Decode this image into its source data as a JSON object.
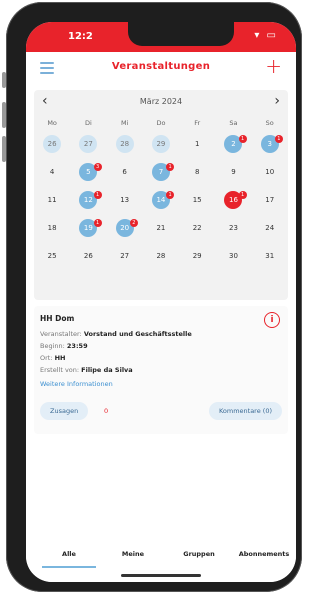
{
  "status": {
    "time": "12:2",
    "icons": "▾ ▭"
  },
  "header": {
    "title": "Veranstaltungen",
    "add": "+"
  },
  "calendar": {
    "prev": "‹",
    "next": "›",
    "month": "März 2024",
    "weekdays": [
      "Mo",
      "Di",
      "Mi",
      "Do",
      "Fr",
      "Sa",
      "So"
    ],
    "weeks": [
      [
        {
          "d": "26",
          "s": "light"
        },
        {
          "d": "27",
          "s": "light"
        },
        {
          "d": "28",
          "s": "light"
        },
        {
          "d": "29",
          "s": "light"
        },
        {
          "d": "1",
          "s": ""
        },
        {
          "d": "2",
          "s": "event",
          "b": "1"
        },
        {
          "d": "3",
          "s": "event",
          "b": "1"
        }
      ],
      [
        {
          "d": "4",
          "s": ""
        },
        {
          "d": "5",
          "s": "event",
          "b": "3"
        },
        {
          "d": "6",
          "s": ""
        },
        {
          "d": "7",
          "s": "event",
          "b": "1"
        },
        {
          "d": "8",
          "s": ""
        },
        {
          "d": "9",
          "s": ""
        },
        {
          "d": "10",
          "s": ""
        }
      ],
      [
        {
          "d": "11",
          "s": ""
        },
        {
          "d": "12",
          "s": "event",
          "b": "1"
        },
        {
          "d": "13",
          "s": ""
        },
        {
          "d": "14",
          "s": "event",
          "b": "1"
        },
        {
          "d": "15",
          "s": ""
        },
        {
          "d": "16",
          "s": "today",
          "b": "1"
        },
        {
          "d": "17",
          "s": ""
        }
      ],
      [
        {
          "d": "18",
          "s": ""
        },
        {
          "d": "19",
          "s": "event",
          "b": "1"
        },
        {
          "d": "20",
          "s": "event",
          "b": "2"
        },
        {
          "d": "21",
          "s": ""
        },
        {
          "d": "22",
          "s": ""
        },
        {
          "d": "23",
          "s": ""
        },
        {
          "d": "24",
          "s": ""
        }
      ],
      [
        {
          "d": "25",
          "s": ""
        },
        {
          "d": "26",
          "s": ""
        },
        {
          "d": "27",
          "s": ""
        },
        {
          "d": "28",
          "s": ""
        },
        {
          "d": "29",
          "s": ""
        },
        {
          "d": "30",
          "s": ""
        },
        {
          "d": "31",
          "s": ""
        }
      ]
    ]
  },
  "event": {
    "title": "HH Dom",
    "organizer_label": "Veranstalter:",
    "organizer": "Vorstand und Geschäftsstelle",
    "start_label": "Beginn:",
    "start": "23:59",
    "place_label": "Ort:",
    "place": "HH",
    "created_label": "Erstellt von:",
    "created_by": "Filipe da Silva",
    "more": "Weitere Informationen",
    "accept": "Zusagen",
    "accept_count": "0",
    "comments": "Kommentare (0)",
    "info": "i"
  },
  "tabs": [
    "Alle",
    "Meine",
    "Gruppen",
    "Abonnements"
  ],
  "colors": {
    "accent": "#e8232b",
    "event": "#7ab6de"
  }
}
